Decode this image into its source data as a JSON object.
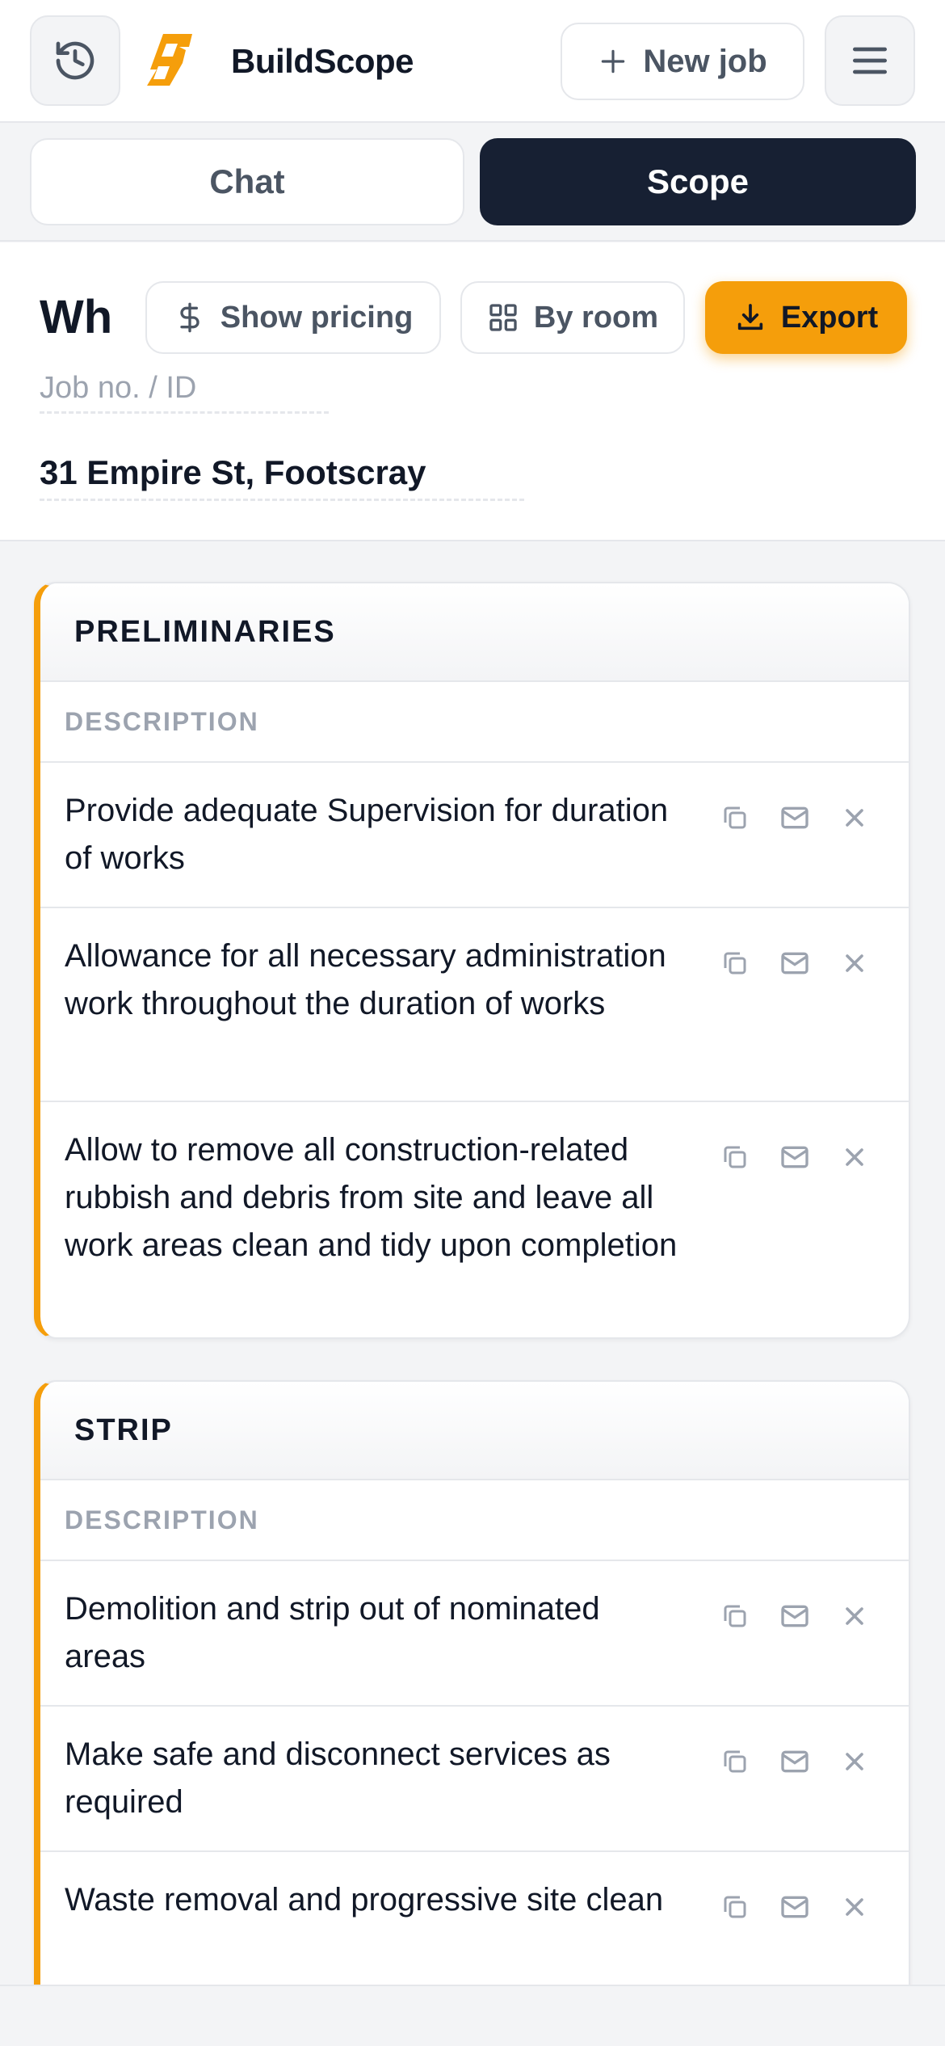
{
  "header": {
    "brand": "BuildScope",
    "new_job_label": "New job",
    "icons": {
      "history": "history-icon",
      "menu": "hamburger-menu-icon",
      "logo": "buildscope-logo"
    }
  },
  "tabs": [
    {
      "label": "Chat",
      "active": false
    },
    {
      "label": "Scope",
      "active": true
    }
  ],
  "job": {
    "title": "Wh",
    "show_pricing_label": "Show pricing",
    "by_room_label": "By room",
    "export_label": "Export",
    "job_id_placeholder": "Job no. / ID",
    "address": "31 Empire St, Footscray"
  },
  "sections": [
    {
      "title": "PRELIMINARIES",
      "column_header": "DESCRIPTION",
      "items": [
        "Provide adequate Supervision for duration of works",
        "Allowance for all necessary administration work throughout the duration of works",
        "Allow to remove all construction-related rubbish and debris from site and leave all work areas clean and tidy upon completion"
      ]
    },
    {
      "title": "STRIP",
      "column_header": "DESCRIPTION",
      "items": [
        "Demolition and strip out of nominated areas",
        "Make safe and disconnect services as required",
        "Waste removal and progressive site clean"
      ]
    }
  ],
  "colors": {
    "accent": "#f59e0b",
    "dark": "#172033",
    "border": "#e5e7eb"
  }
}
